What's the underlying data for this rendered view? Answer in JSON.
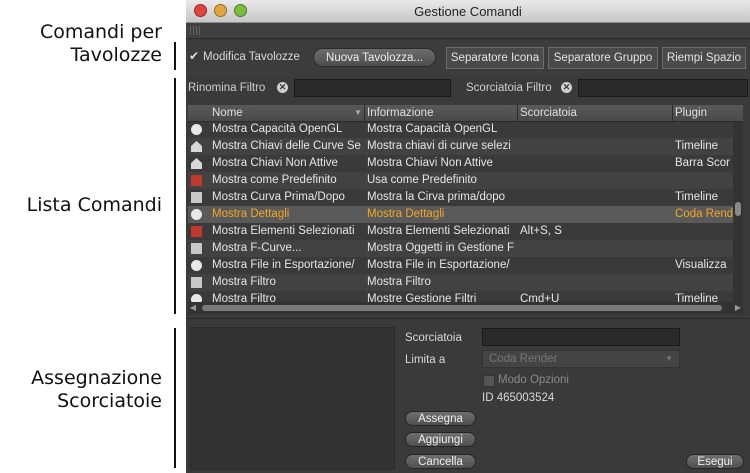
{
  "callouts": {
    "toolbar": "Comandi per Tavolozze",
    "list": "Lista Comandi",
    "shortcut": "Assegnazione Scorciatoie"
  },
  "window": {
    "title": "Gestione Comandi"
  },
  "toolbar": {
    "checkbox_label": "Modifica Tavolozze",
    "new_palette": "Nuova Tavolozza...",
    "icon_separator": "Separatore Icona",
    "group_separator": "Separatore Gruppo",
    "fill_space": "Riempi Spazio"
  },
  "filters": {
    "rename_label": "Rinomina Filtro",
    "shortcut_label": "Scorciatoia Filtro"
  },
  "table": {
    "columns": [
      "Nome",
      "Informazione",
      "Scorciatoia",
      "Plugin"
    ],
    "rows": [
      {
        "icon": "round-icon",
        "name": "Mostra Capacità OpenGL",
        "info": "Mostra Capacità OpenGL",
        "shortcut": "",
        "plugin": ""
      },
      {
        "icon": "house-icon",
        "name": "Mostra Chiavi delle Curve Se",
        "info": "Mostra chiavi di curve selezi",
        "shortcut": "",
        "plugin": "Timeline"
      },
      {
        "icon": "house-icon",
        "name": "Mostra Chiavi Non Attive",
        "info": "Mostra Chiavi Non Attive",
        "shortcut": "",
        "plugin": "Barra Scor"
      },
      {
        "icon": "red-box-icon",
        "name": "Mostra come Predefinito",
        "info": "Usa come Predefinito",
        "shortcut": "",
        "plugin": ""
      },
      {
        "icon": "box-icon",
        "name": "Mostra Curva Prima/Dopo",
        "info": "Mostra la Cirva prima/dopo",
        "shortcut": "",
        "plugin": "Timeline"
      },
      {
        "icon": "round-icon",
        "name": "Mostra Dettagli",
        "info": "Mostra Dettagli",
        "shortcut": "",
        "plugin": "Coda Rend",
        "selected": true
      },
      {
        "icon": "red-box-icon",
        "name": "Mostra Elementi Selezionati",
        "info": "Mostra Elementi Selezionati",
        "shortcut": "Alt+S, S",
        "plugin": ""
      },
      {
        "icon": "box-icon",
        "name": "Mostra F-Curve...",
        "info": "Mostra Oggetti in Gestione F",
        "shortcut": "",
        "plugin": ""
      },
      {
        "icon": "round-icon",
        "name": "Mostra File in Esportazione/",
        "info": "Mostra File in Esportazione/",
        "shortcut": "",
        "plugin": "Visualizza"
      },
      {
        "icon": "box-icon",
        "name": "Mostra Filtro",
        "info": "Mostra Filtro",
        "shortcut": "",
        "plugin": ""
      },
      {
        "icon": "round-icon",
        "name": "Mostra Filtro",
        "info": "Mostre Gestione Filtri",
        "shortcut": "Cmd+U",
        "plugin": "Timeline"
      }
    ]
  },
  "assign": {
    "shortcut_label": "Scorciatoia",
    "limit_label": "Limita a",
    "limit_value": "Coda Render",
    "options_mode_label": "Modo Opzioni",
    "id_text": "ID 465003524",
    "assign_button": "Assegna",
    "add_button": "Aggiungi",
    "delete_button": "Cancella",
    "execute_button": "Esegui"
  },
  "colors": {
    "selected_text": "#f5a623",
    "window_bg": "#3a3a3a"
  }
}
